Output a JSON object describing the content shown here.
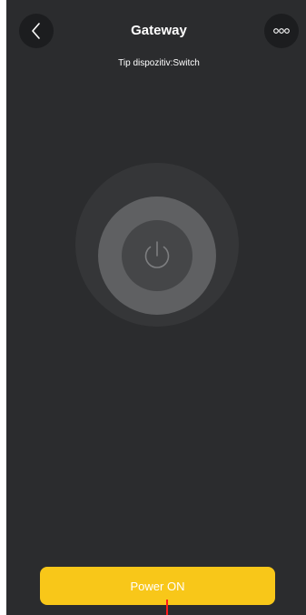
{
  "header": {
    "title": "Gateway",
    "subtitle": "Tip dispozitiv:Switch",
    "back_icon": "chevron-left-icon",
    "more_icon": "more-dots-icon"
  },
  "power": {
    "icon": "power-icon"
  },
  "footer": {
    "power_button_label": "Power ON"
  },
  "colors": {
    "background": "#2b2c2e",
    "accent": "#f8c719",
    "pointer": "#ff1a1a"
  }
}
